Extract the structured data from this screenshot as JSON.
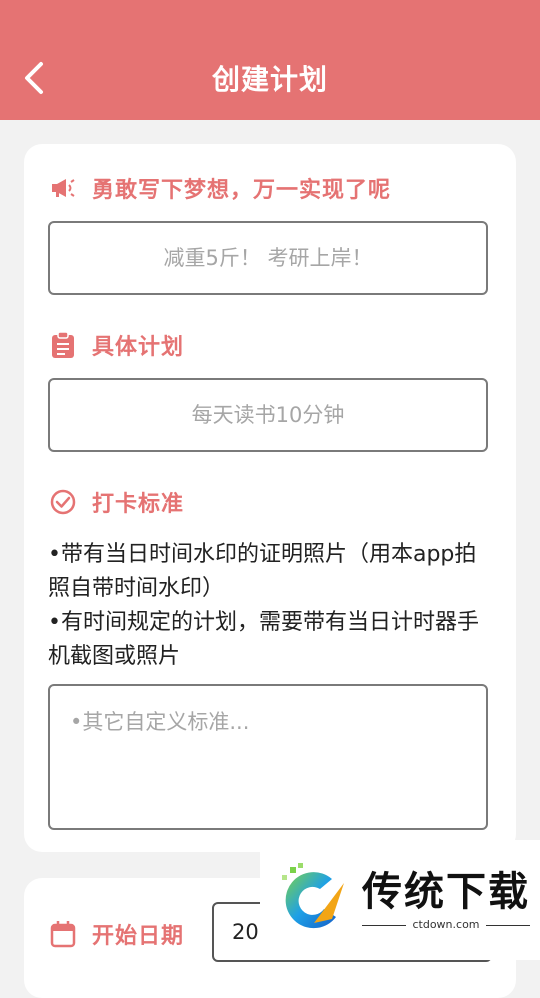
{
  "header": {
    "title": "创建计划"
  },
  "dream": {
    "label": "勇敢写下梦想，万一实现了呢",
    "placeholder": "减重5斤！ 考研上岸！",
    "icon": "megaphone-icon"
  },
  "plan": {
    "label": "具体计划",
    "placeholder": "每天读书10分钟",
    "icon": "clipboard-icon"
  },
  "standard": {
    "label": "打卡标准",
    "icon": "check-circle-icon",
    "lines": [
      "•带有当日时间水印的证明照片（用本app拍照自带时间水印）",
      "•有时间规定的计划，需要带有当日计时器手机截图或照片"
    ],
    "placeholder": "•其它自定义标准..."
  },
  "start_date": {
    "label": "开始日期",
    "value": "20",
    "icon": "calendar-icon"
  },
  "watermark": {
    "name": "传统下载",
    "url": "ctdown.com"
  },
  "colors": {
    "accent": "#e57373",
    "background": "#f2f2f2"
  }
}
